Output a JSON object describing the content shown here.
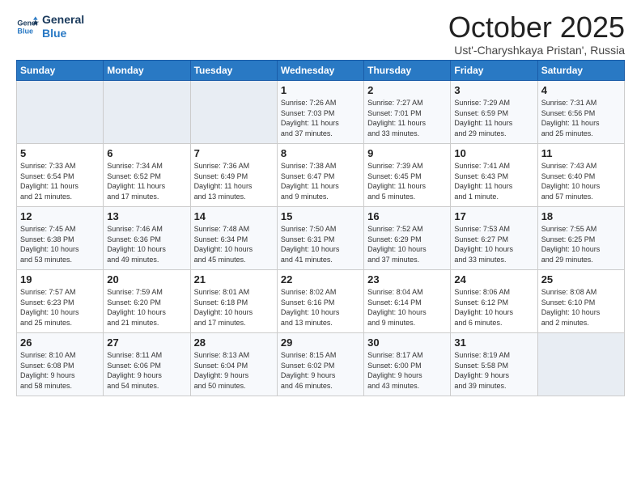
{
  "logo": {
    "line1": "General",
    "line2": "Blue"
  },
  "title": "October 2025",
  "subtitle": "Ust'-Charyshkaya Pristan', Russia",
  "days_of_week": [
    "Sunday",
    "Monday",
    "Tuesday",
    "Wednesday",
    "Thursday",
    "Friday",
    "Saturday"
  ],
  "weeks": [
    [
      {
        "day": "",
        "info": ""
      },
      {
        "day": "",
        "info": ""
      },
      {
        "day": "",
        "info": ""
      },
      {
        "day": "1",
        "info": "Sunrise: 7:26 AM\nSunset: 7:03 PM\nDaylight: 11 hours\nand 37 minutes."
      },
      {
        "day": "2",
        "info": "Sunrise: 7:27 AM\nSunset: 7:01 PM\nDaylight: 11 hours\nand 33 minutes."
      },
      {
        "day": "3",
        "info": "Sunrise: 7:29 AM\nSunset: 6:59 PM\nDaylight: 11 hours\nand 29 minutes."
      },
      {
        "day": "4",
        "info": "Sunrise: 7:31 AM\nSunset: 6:56 PM\nDaylight: 11 hours\nand 25 minutes."
      }
    ],
    [
      {
        "day": "5",
        "info": "Sunrise: 7:33 AM\nSunset: 6:54 PM\nDaylight: 11 hours\nand 21 minutes."
      },
      {
        "day": "6",
        "info": "Sunrise: 7:34 AM\nSunset: 6:52 PM\nDaylight: 11 hours\nand 17 minutes."
      },
      {
        "day": "7",
        "info": "Sunrise: 7:36 AM\nSunset: 6:49 PM\nDaylight: 11 hours\nand 13 minutes."
      },
      {
        "day": "8",
        "info": "Sunrise: 7:38 AM\nSunset: 6:47 PM\nDaylight: 11 hours\nand 9 minutes."
      },
      {
        "day": "9",
        "info": "Sunrise: 7:39 AM\nSunset: 6:45 PM\nDaylight: 11 hours\nand 5 minutes."
      },
      {
        "day": "10",
        "info": "Sunrise: 7:41 AM\nSunset: 6:43 PM\nDaylight: 11 hours\nand 1 minute."
      },
      {
        "day": "11",
        "info": "Sunrise: 7:43 AM\nSunset: 6:40 PM\nDaylight: 10 hours\nand 57 minutes."
      }
    ],
    [
      {
        "day": "12",
        "info": "Sunrise: 7:45 AM\nSunset: 6:38 PM\nDaylight: 10 hours\nand 53 minutes."
      },
      {
        "day": "13",
        "info": "Sunrise: 7:46 AM\nSunset: 6:36 PM\nDaylight: 10 hours\nand 49 minutes."
      },
      {
        "day": "14",
        "info": "Sunrise: 7:48 AM\nSunset: 6:34 PM\nDaylight: 10 hours\nand 45 minutes."
      },
      {
        "day": "15",
        "info": "Sunrise: 7:50 AM\nSunset: 6:31 PM\nDaylight: 10 hours\nand 41 minutes."
      },
      {
        "day": "16",
        "info": "Sunrise: 7:52 AM\nSunset: 6:29 PM\nDaylight: 10 hours\nand 37 minutes."
      },
      {
        "day": "17",
        "info": "Sunrise: 7:53 AM\nSunset: 6:27 PM\nDaylight: 10 hours\nand 33 minutes."
      },
      {
        "day": "18",
        "info": "Sunrise: 7:55 AM\nSunset: 6:25 PM\nDaylight: 10 hours\nand 29 minutes."
      }
    ],
    [
      {
        "day": "19",
        "info": "Sunrise: 7:57 AM\nSunset: 6:23 PM\nDaylight: 10 hours\nand 25 minutes."
      },
      {
        "day": "20",
        "info": "Sunrise: 7:59 AM\nSunset: 6:20 PM\nDaylight: 10 hours\nand 21 minutes."
      },
      {
        "day": "21",
        "info": "Sunrise: 8:01 AM\nSunset: 6:18 PM\nDaylight: 10 hours\nand 17 minutes."
      },
      {
        "day": "22",
        "info": "Sunrise: 8:02 AM\nSunset: 6:16 PM\nDaylight: 10 hours\nand 13 minutes."
      },
      {
        "day": "23",
        "info": "Sunrise: 8:04 AM\nSunset: 6:14 PM\nDaylight: 10 hours\nand 9 minutes."
      },
      {
        "day": "24",
        "info": "Sunrise: 8:06 AM\nSunset: 6:12 PM\nDaylight: 10 hours\nand 6 minutes."
      },
      {
        "day": "25",
        "info": "Sunrise: 8:08 AM\nSunset: 6:10 PM\nDaylight: 10 hours\nand 2 minutes."
      }
    ],
    [
      {
        "day": "26",
        "info": "Sunrise: 8:10 AM\nSunset: 6:08 PM\nDaylight: 9 hours\nand 58 minutes."
      },
      {
        "day": "27",
        "info": "Sunrise: 8:11 AM\nSunset: 6:06 PM\nDaylight: 9 hours\nand 54 minutes."
      },
      {
        "day": "28",
        "info": "Sunrise: 8:13 AM\nSunset: 6:04 PM\nDaylight: 9 hours\nand 50 minutes."
      },
      {
        "day": "29",
        "info": "Sunrise: 8:15 AM\nSunset: 6:02 PM\nDaylight: 9 hours\nand 46 minutes."
      },
      {
        "day": "30",
        "info": "Sunrise: 8:17 AM\nSunset: 6:00 PM\nDaylight: 9 hours\nand 43 minutes."
      },
      {
        "day": "31",
        "info": "Sunrise: 8:19 AM\nSunset: 5:58 PM\nDaylight: 9 hours\nand 39 minutes."
      },
      {
        "day": "",
        "info": ""
      }
    ]
  ]
}
